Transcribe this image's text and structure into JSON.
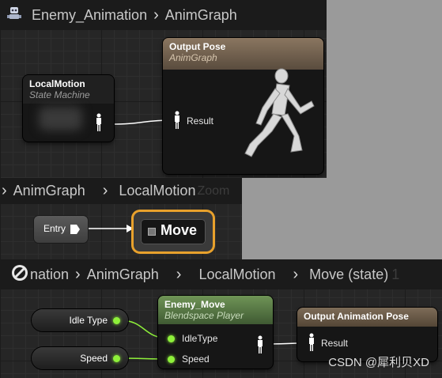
{
  "top_graph": {
    "breadcrumb": [
      "Enemy_Animation",
      "AnimGraph"
    ],
    "local_motion_node": {
      "title": "LocalMotion",
      "subtitle": "State Machine"
    },
    "output_pose_node": {
      "title": "Output Pose",
      "subtitle": "AnimGraph",
      "pin": "Result"
    }
  },
  "mid_graph": {
    "breadcrumb": [
      "AnimGraph",
      "LocalMotion"
    ],
    "ghost_text": "Zoom",
    "entry_label": "Entry",
    "state_label": "Move"
  },
  "bottom_graph": {
    "breadcrumb": [
      "nation",
      "AnimGraph",
      "LocalMotion",
      "Move (state)"
    ],
    "ghost_text": "1",
    "var_idle": "Idle Type",
    "var_speed": "Speed",
    "blend_node": {
      "title": "Enemy_Move",
      "subtitle": "Blendspace Player",
      "pin_idle": "IdleType",
      "pin_speed": "Speed"
    },
    "output_node": {
      "title": "Output Animation Pose",
      "pin": "Result"
    }
  },
  "watermark": "CSDN @犀利贝XD",
  "colors": {
    "accent_orange": "#e8a12c",
    "pin_green": "#8ef03a",
    "blend_header": "#5b7a45",
    "output_header": "#6e5e4a"
  }
}
